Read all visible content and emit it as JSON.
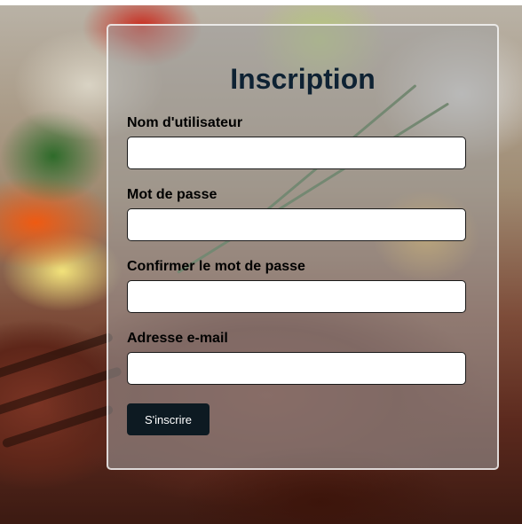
{
  "form": {
    "title": "Inscription",
    "fields": [
      {
        "label": "Nom d'utilisateur",
        "value": "",
        "placeholder": ""
      },
      {
        "label": "Mot de passe",
        "value": "",
        "placeholder": ""
      },
      {
        "label": "Confirmer le mot de passe",
        "value": "",
        "placeholder": ""
      },
      {
        "label": "Adresse e-mail",
        "value": "",
        "placeholder": ""
      }
    ],
    "submit_label": "S'inscrire"
  },
  "colors": {
    "title": "#0e2233",
    "button_bg": "#0d1a22",
    "button_text": "#ffffff",
    "card_bg": "rgba(160,160,160,0.55)"
  }
}
